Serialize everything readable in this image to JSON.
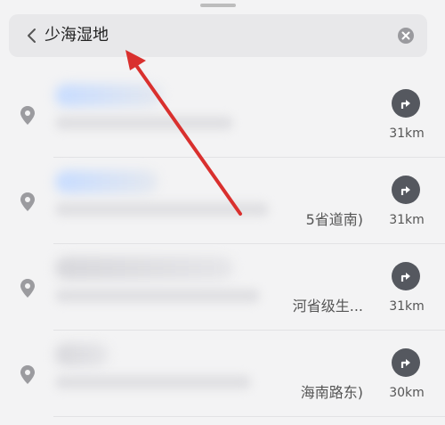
{
  "search": {
    "query": "少海湿地"
  },
  "results": [
    {
      "address_partial": "",
      "distance": "31km"
    },
    {
      "address_partial": "5省道南)",
      "distance": "31km"
    },
    {
      "address_partial": "河省级生...",
      "distance": "31km"
    },
    {
      "address_partial": "海南路东)",
      "distance": "30km"
    }
  ],
  "colors": {
    "annotation_arrow": "#d9302e",
    "nav_button": "#55585f"
  },
  "icons": {
    "back": "chevron-left-icon",
    "clear": "clear-icon",
    "pin": "location-pin-icon",
    "navigate": "route-turn-icon"
  }
}
